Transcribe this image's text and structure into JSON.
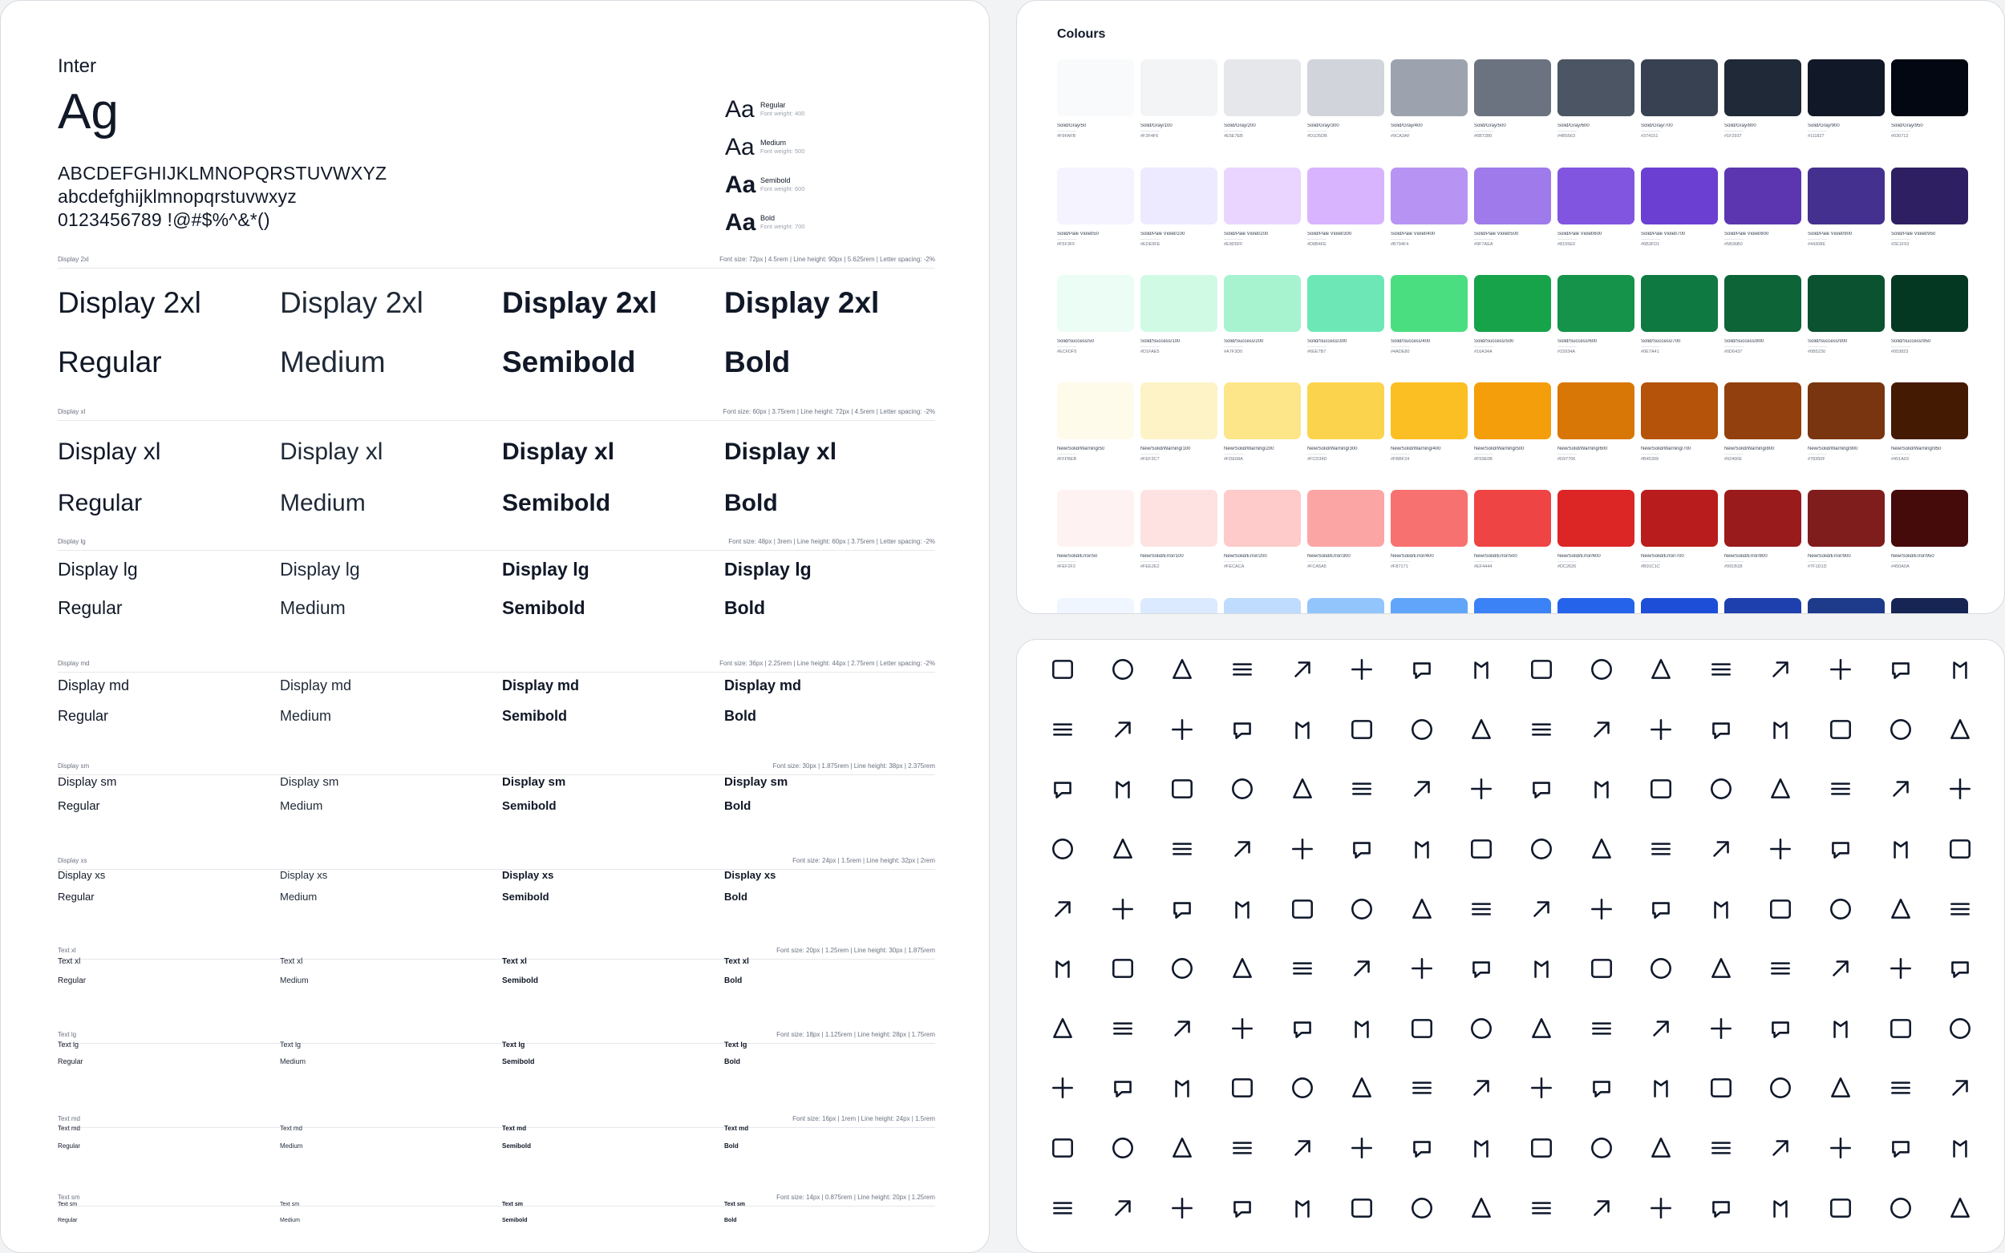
{
  "typography": {
    "font_name": "Inter",
    "sample": "Ag",
    "uppercase": "ABCDEFGHIJKLMNOPQRSTUVWXYZ",
    "lowercase": "abcdefghijklmnopqrstuvwxyz",
    "digits": "0123456789 !@#$%^&*()",
    "aa": "Aa",
    "weights": [
      {
        "name": "Regular",
        "meta": "Font weight: 400"
      },
      {
        "name": "Medium",
        "meta": "Font weight: 500"
      },
      {
        "name": "Semibold",
        "meta": "Font weight: 600"
      },
      {
        "name": "Bold",
        "meta": "Font weight: 700"
      }
    ],
    "scales": [
      {
        "label": "Display 2xl",
        "spec": "Font size: 72px | 4.5rem | Line height: 90px | 5.625rem | Letter spacing: -2%",
        "sample": "Display 2xl"
      },
      {
        "label": "Display xl",
        "spec": "Font size: 60px | 3.75rem | Line height: 72px | 4.5rem | Letter spacing: -2%",
        "sample": "Display xl"
      },
      {
        "label": "Display lg",
        "spec": "Font size: 48px | 3rem | Line height: 60px | 3.75rem | Letter spacing: -2%",
        "sample": "Display lg"
      },
      {
        "label": "Display md",
        "spec": "Font size: 36px | 2.25rem | Line height: 44px | 2.75rem | Letter spacing: -2%",
        "sample": "Display md"
      },
      {
        "label": "Display sm",
        "spec": "Font size: 30px | 1.875rem | Line height: 38px | 2.375rem",
        "sample": "Display sm"
      },
      {
        "label": "Display xs",
        "spec": "Font size: 24px | 1.5rem | Line height: 32px | 2rem",
        "sample": "Display xs"
      },
      {
        "label": "Text xl",
        "spec": "Font size: 20px | 1.25rem | Line height: 30px | 1.875rem",
        "sample": "Text xl"
      },
      {
        "label": "Text lg",
        "spec": "Font size: 18px | 1.125rem | Line height: 28px | 1.75rem",
        "sample": "Text lg"
      },
      {
        "label": "Text md",
        "spec": "Font size: 16px | 1rem | Line height: 24px | 1.5rem",
        "sample": "Text md"
      },
      {
        "label": "Text sm",
        "spec": "Font size: 14px | 0.875rem | Line height: 20px | 1.25rem",
        "sample": "Text sm"
      }
    ],
    "weight_labels": [
      "Regular",
      "Medium",
      "Semibold",
      "Bold"
    ]
  },
  "colours": {
    "title": "Colours",
    "rows": [
      {
        "prefix": "Solid/Gray/",
        "steps": [
          "50",
          "100",
          "200",
          "300",
          "400",
          "500",
          "600",
          "700",
          "800",
          "900",
          "950"
        ],
        "colors": [
          "#f9fafb",
          "#f3f4f6",
          "#e5e7eb",
          "#d1d5db",
          "#9ca3af",
          "#6b7280",
          "#4b5563",
          "#374151",
          "#1f2937",
          "#111827",
          "#030712"
        ]
      },
      {
        "prefix": "Solid/Pale Violet/",
        "steps": [
          "50",
          "100",
          "200",
          "300",
          "400",
          "500",
          "600",
          "700",
          "800",
          "900",
          "950"
        ],
        "colors": [
          "#f5f3ff",
          "#ede9fe",
          "#e9d5ff",
          "#d8b4fe",
          "#b794f4",
          "#9f7aea",
          "#8155e0",
          "#6b3fd1",
          "#5b36b0",
          "#44308e",
          "#2e1f63"
        ]
      },
      {
        "prefix": "Solid/Success/",
        "steps": [
          "50",
          "100",
          "200",
          "300",
          "400",
          "500",
          "600",
          "700",
          "800",
          "900",
          "950"
        ],
        "colors": [
          "#ecfdf5",
          "#d1fae5",
          "#a7f3d0",
          "#6ee7b7",
          "#4ade80",
          "#16a34a",
          "#15934a",
          "#0e7a41",
          "#0d6437",
          "#0b5230",
          "#053823"
        ]
      },
      {
        "prefix": "New/Solid/Warning/",
        "steps": [
          "50",
          "100",
          "200",
          "300",
          "400",
          "500",
          "600",
          "700",
          "800",
          "900",
          "950"
        ],
        "colors": [
          "#fffbeb",
          "#fef3c7",
          "#fde68a",
          "#fcd34d",
          "#fbbf24",
          "#f59e0b",
          "#d97706",
          "#b45309",
          "#92400e",
          "#78350f",
          "#451a03"
        ]
      },
      {
        "prefix": "New/Solid/Error/",
        "steps": [
          "50",
          "100",
          "200",
          "300",
          "400",
          "500",
          "600",
          "700",
          "800",
          "900",
          "950"
        ],
        "colors": [
          "#fef2f2",
          "#fee2e2",
          "#fecaca",
          "#fca5a5",
          "#f87171",
          "#ef4444",
          "#dc2626",
          "#b91c1c",
          "#991b1b",
          "#7f1d1d",
          "#450a0a"
        ]
      }
    ],
    "peek_colors": [
      "#eff6ff",
      "#dbeafe",
      "#bfdbfe",
      "#93c5fd",
      "#60a5fa",
      "#3b82f6",
      "#2563eb",
      "#1d4ed8",
      "#1e40af",
      "#1e3a8a",
      "#172554"
    ]
  },
  "icons": [
    [
      "pat-off-icon",
      "pes-off-icon",
      "pht-off-icon",
      "dne-off-icon",
      "tkq-off-icon",
      "pentagram-icon",
      "focus-box-icon",
      "photo-off-icon",
      "inbox-icon",
      "message-ai-icon",
      "message-check-icon",
      "message-star-icon",
      "message-x-icon",
      "binary-tree-icon",
      "stethoscope-icon",
      "phone-icon"
    ],
    [
      "ladder-off-icon",
      "ladder-icon",
      "ladle-icon",
      "lamp-2-icon",
      "lamp-off-icon",
      "lamp-icon",
      "columns-line-icon",
      "laurel-wreath-1-icon",
      "laurel-wreath-2-icon",
      "laurel-wreath-3-icon",
      "laurel-wreath-icon",
      "layout-bottombar-icon",
      "layout-navbar-icon",
      "layout-sidebar-icon",
      "layout-sidebar-right-icon",
      "leaf-icon"
    ],
    [
      "lifebuoy-off-icon",
      "lifebuoy-icon",
      "lighter-icon",
      "line-scan-icon",
      "link-off-icon",
      "link-plus-icon",
      "list-letters-icon",
      "list-details-icon",
      "location-bolt-icon",
      "location-cog-icon",
      "location-icon",
      "location-code-icon",
      "location-check-icon",
      "location-discount-icon",
      "location-dollar-icon",
      "location-down-icon"
    ],
    [
      "location-share-icon",
      "location-star-icon",
      "location-up-icon",
      "location-x-icon",
      "lock-cog-icon",
      "lock-open-icon",
      "lock-icon",
      "login-icon",
      "logs-icon",
      "luggage-off-icon",
      "luggage-icon",
      "magnet-off-icon",
      "magnet-icon",
      "anchor-icon",
      "mail-cog-icon",
      "man-icon"
    ],
    [
      "map-down-icon",
      "map-exclamation-icon",
      "map-heart-icon",
      "map-icon",
      "map-pause-icon",
      "map-pin-icon",
      "map-plus-icon",
      "map-question-icon",
      "map-2-icon",
      "map-share-icon",
      "map-star-icon",
      "map-up-icon",
      "map-x-icon",
      "marquee-icon",
      "marquee-off-icon",
      "marquee-2-icon"
    ],
    [
      "menu-left-icon",
      "menu-center-icon",
      "menu-right-icon",
      "message-user-icon",
      "message-reply-icon",
      "message-2-user-icon",
      "meter-cube-icon",
      "meter-square-icon",
      "microphone-icon",
      "mickey-icon",
      "mood-wink-icon",
      "mobiledata-icon",
      "minus-vertical-icon",
      "mist-off-icon",
      "arrows-up-down-icon",
      "moneybag-icon"
    ],
    [
      "music-check-icon",
      "music-cog-icon",
      "music-code-icon",
      "music-discount-icon",
      "music-dollar-icon",
      "music-down-icon",
      "music-exclamation-icon",
      "music-heart-icon",
      "music-minus-icon",
      "music-pause-icon",
      "music-pin-icon",
      "music-plus-icon",
      "music-question-icon",
      "music-search-icon",
      "music-share-icon",
      "music-star-icon"
    ],
    [
      "navigation-dollar-icon",
      "navigation-down-icon",
      "navigation-exclamation-icon",
      "navigation-heart-icon",
      "navigation-minus-icon",
      "navigation-pause-icon",
      "navigation-pin-icon",
      "navigation-plus-icon",
      "navigation-question-icon",
      "navigation-search-icon",
      "navigation-share-icon",
      "navigation-star-icon",
      "navigation-up-icon",
      "navigation-x-icon",
      "needle-thread-icon",
      "pencil-icon"
    ],
    [
      "package-import-icon",
      "packages-icon",
      "pacman-icon",
      "paperclip-icon",
      "parking-circle-icon",
      "paw-off-icon",
      "paw-icon",
      "lock-dollar-icon",
      "pencil-bolt-icon",
      "pencil-cog-icon",
      "pencil-code-icon",
      "pencil-check-icon",
      "pencil-cog-2-icon",
      "pencil-discount-icon",
      "pencil-dollar-icon",
      "pencil-down-icon"
    ],
    [
      "pencil-up-icon",
      "pencil-x-icon",
      "pentagon-icon",
      "pentagon-plus-icon",
      "pentagon-x-icon",
      "pentagon-star-icon",
      "circle-icon",
      "progress-1-icon",
      "progress-2-icon",
      "progress-3-icon",
      "progress-4-icon",
      "progress-5-icon",
      "progress-6-icon",
      "progress-7-icon",
      "progress-8-icon",
      "progress-9-icon"
    ]
  ]
}
